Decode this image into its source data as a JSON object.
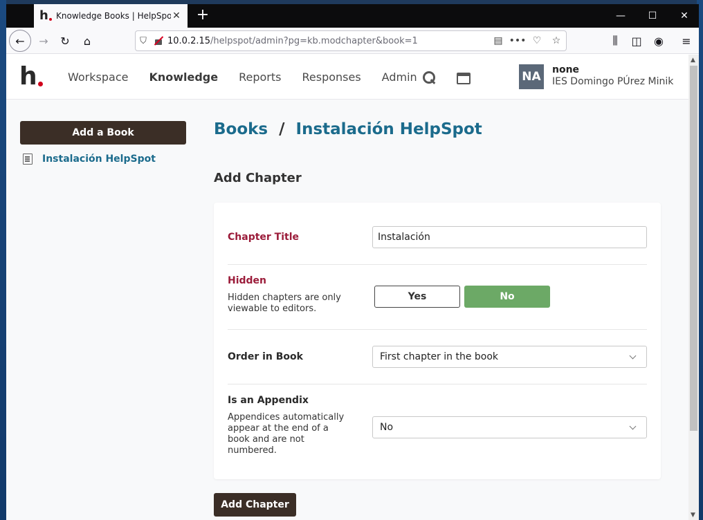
{
  "browser": {
    "tab_title": "Knowledge Books | HelpSpot",
    "url_host": "10.0.2.15",
    "url_path": "/helpspot/admin?pg=kb.modchapter&book=1"
  },
  "app": {
    "nav": [
      "Workspace",
      "Knowledge",
      "Reports",
      "Responses",
      "Admin"
    ],
    "active_nav": "Knowledge",
    "user": {
      "initials": "NA",
      "name": "none",
      "org": "IES Domingo PÚrez Minik"
    }
  },
  "sidebar": {
    "add_book_label": "Add a Book",
    "items": [
      {
        "label": "Instalación HelpSpot"
      }
    ]
  },
  "breadcrumb": {
    "root": "Books",
    "separator": "/",
    "current": "Instalación HelpSpot"
  },
  "form": {
    "heading": "Add Chapter",
    "chapter_title": {
      "label": "Chapter Title",
      "value": "Instalación"
    },
    "hidden": {
      "label": "Hidden",
      "help": "Hidden chapters are only viewable to editors.",
      "yes_label": "Yes",
      "no_label": "No",
      "selected": "No"
    },
    "order": {
      "label": "Order in Book",
      "value": "First chapter in the book"
    },
    "appendix": {
      "label": "Is an Appendix",
      "help": "Appendices automatically appear at the end of a book and are not numbered.",
      "value": "No"
    },
    "submit_label": "Add Chapter"
  },
  "colors": {
    "brand_dark": "#3b2e26",
    "link_blue": "#1b6b8c",
    "label_red": "#9b1c3a",
    "toggle_green": "#6ca966",
    "logo_dot": "#d0021b"
  }
}
